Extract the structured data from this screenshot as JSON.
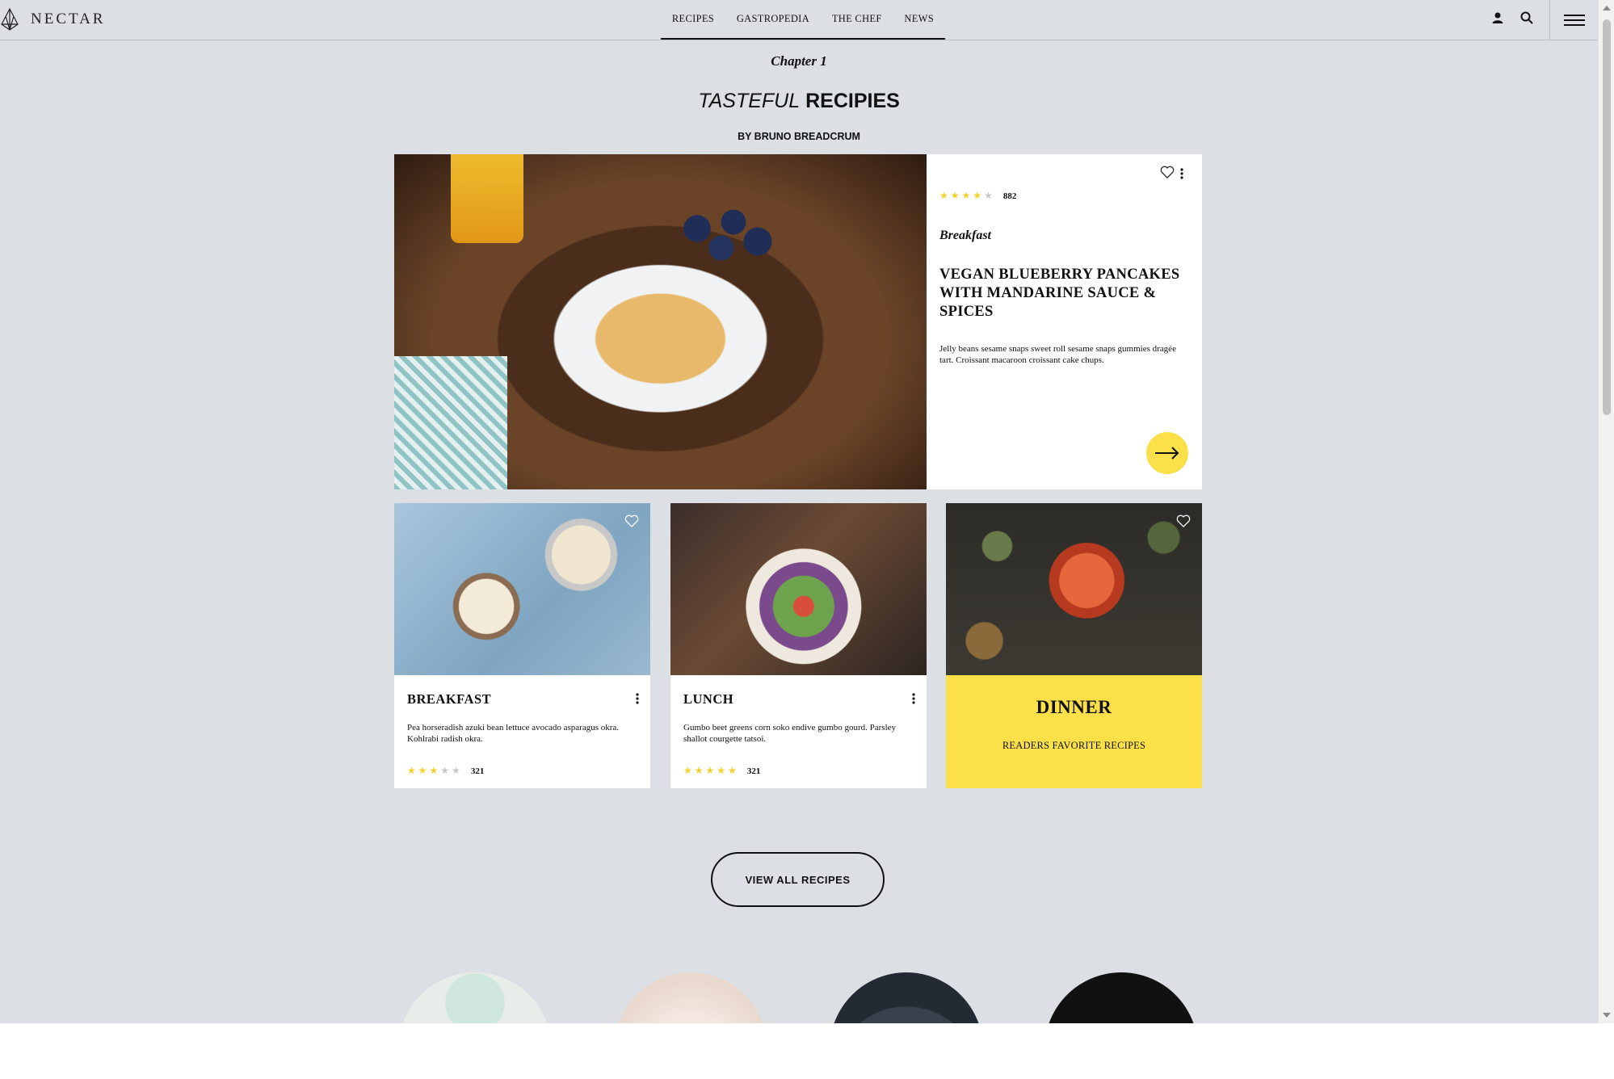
{
  "brand": {
    "name": "NECTAR"
  },
  "nav": {
    "items": [
      "RECIPES",
      "GASTROPEDIA",
      "THE CHEF",
      "NEWS"
    ]
  },
  "header_icons": [
    "user-icon",
    "search-icon",
    "hamburger-menu-icon"
  ],
  "section": {
    "chapter": "Chapter 1",
    "title_light": "TASTEFUL",
    "title_bold": "RECIPIES",
    "byline": "BY BRUNO BREADCRUM"
  },
  "featured": {
    "rating": 4,
    "rating_max": 5,
    "rating_count": "882",
    "category": "Breakfast",
    "title": "VEGAN BLUEBERRY PANCAKES WITH MANDARINE SAUCE & SPICES",
    "description": "Jelly beans sesame snaps sweet roll sesame snaps gummies dragée tart. Croissant macaroon croissant cake chups."
  },
  "cards": [
    {
      "title": "BREAKFAST",
      "description": "Pea horseradish azuki bean lettuce avocado asparagus okra. Kohlrabi radish okra.",
      "rating": 3,
      "rating_count": "321"
    },
    {
      "title": "LUNCH",
      "description": "Gumbo beet greens corn soko endive gumbo gourd. Parsley shallot courgette tatsoi.",
      "rating": 5,
      "rating_count": "321"
    }
  ],
  "dinner": {
    "title": "DINNER",
    "subtitle": "READERS FAVORITE RECIPES"
  },
  "view_all_label": "VIEW ALL RECIPES",
  "colors": {
    "page_bg": "#dcdfe3",
    "accent_yellow": "#fbe04a",
    "star_filled": "#f5d02a",
    "star_empty": "#c7c7c7",
    "text": "#111111"
  }
}
